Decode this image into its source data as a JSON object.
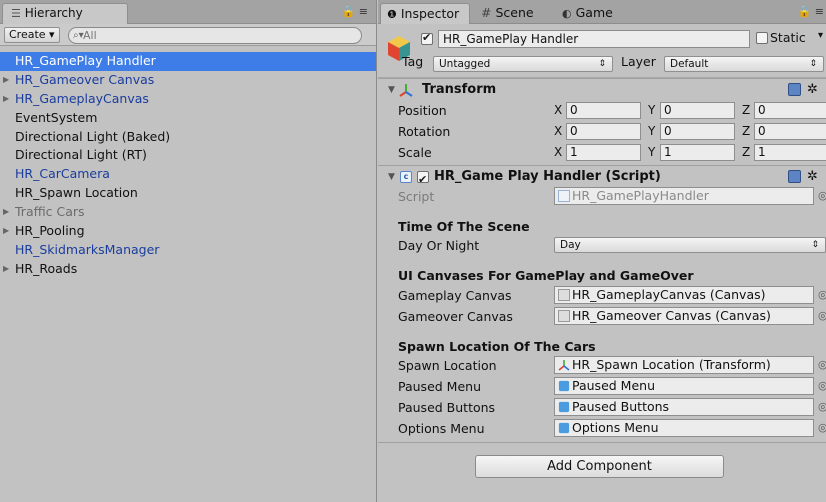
{
  "hierarchy": {
    "tab_label": "Hierarchy",
    "tab_icon": "list-icon",
    "menu_icon": "≡",
    "create_label": "Create ▾",
    "search_placeholder": "All",
    "items": [
      {
        "label": "HR_GamePlay Handler",
        "style": "selected prefab",
        "expandable": false
      },
      {
        "label": "HR_Gameover Canvas",
        "style": "prefab",
        "expandable": true
      },
      {
        "label": "HR_GameplayCanvas",
        "style": "prefab",
        "expandable": true
      },
      {
        "label": "EventSystem",
        "style": "",
        "expandable": false
      },
      {
        "label": "Directional Light (Baked)",
        "style": "",
        "expandable": false
      },
      {
        "label": "Directional Light (RT)",
        "style": "",
        "expandable": false
      },
      {
        "label": "HR_CarCamera",
        "style": "prefab",
        "expandable": false
      },
      {
        "label": "HR_Spawn Location",
        "style": "",
        "expandable": false
      },
      {
        "label": "Traffic Cars",
        "style": "inactive",
        "expandable": true
      },
      {
        "label": "HR_Pooling",
        "style": "",
        "expandable": true
      },
      {
        "label": "HR_SkidmarksManager",
        "style": "prefab",
        "expandable": false
      },
      {
        "label": "HR_Roads",
        "style": "",
        "expandable": true
      }
    ]
  },
  "inspector": {
    "tabs": [
      {
        "label": "Inspector",
        "icon": "info-icon",
        "glyph": "❶",
        "active": true
      },
      {
        "label": "Scene",
        "icon": "grid-icon",
        "glyph": "#",
        "active": false
      },
      {
        "label": "Game",
        "icon": "pacman-icon",
        "glyph": "◐",
        "active": false
      }
    ],
    "object_name": "HR_GamePlay Handler",
    "active_checked": true,
    "static_label": "Static",
    "static_checked": false,
    "tag_label": "Tag",
    "tag_value": "Untagged",
    "layer_label": "Layer",
    "layer_value": "Default",
    "transform": {
      "title": "Transform",
      "rows": [
        {
          "label": "Position",
          "x": "0",
          "y": "0",
          "z": "0"
        },
        {
          "label": "Rotation",
          "x": "0",
          "y": "0",
          "z": "0"
        },
        {
          "label": "Scale",
          "x": "1",
          "y": "1",
          "z": "1"
        }
      ]
    },
    "script_component": {
      "title": "HR_Game Play Handler (Script)",
      "script_label": "Script",
      "script_value": "HR_GamePlayHandler",
      "section_time": "Time Of The Scene",
      "day_night_label": "Day Or Night",
      "day_night_value": "Day",
      "section_ui": "UI Canvases For GamePlay and GameOver",
      "gameplay_canvas_label": "Gameplay Canvas",
      "gameplay_canvas_value": "HR_GameplayCanvas (Canvas)",
      "gameover_canvas_label": "Gameover Canvas",
      "gameover_canvas_value": "HR_Gameover Canvas (Canvas)",
      "section_spawn": "Spawn Location Of The Cars",
      "spawn_label": "Spawn Location",
      "spawn_value": "HR_Spawn Location (Transform)",
      "paused_menu_label": "Paused Menu",
      "paused_menu_value": "Paused Menu",
      "paused_buttons_label": "Paused Buttons",
      "paused_buttons_value": "Paused Buttons",
      "options_menu_label": "Options Menu",
      "options_menu_value": "Options Menu"
    },
    "add_component_label": "Add Component"
  },
  "colors": {
    "selection": "#3e7de7",
    "prefab_text": "#1a3d9e",
    "panel_bg": "#c2c2c2"
  }
}
